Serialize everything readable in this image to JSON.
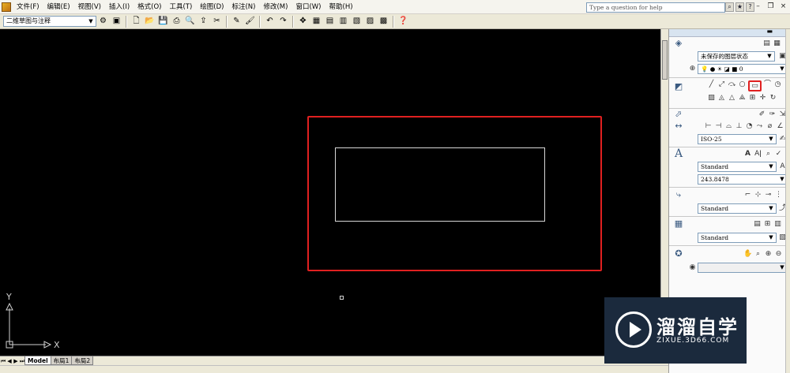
{
  "menu": {
    "items": [
      "文件(F)",
      "编辑(E)",
      "视图(V)",
      "插入(I)",
      "格式(O)",
      "工具(T)",
      "绘图(D)",
      "标注(N)",
      "修改(M)",
      "窗口(W)",
      "帮助(H)"
    ],
    "help_placeholder": "Type a question for help"
  },
  "toolbar": {
    "workspace": "二维草图与注释"
  },
  "layout_tabs": [
    "Model",
    "布局1",
    "布局2"
  ],
  "ucs": {
    "x_label": "X",
    "y_label": "Y"
  },
  "dashboard": {
    "layer_state": "未保存的图层状态",
    "layer_current": "0",
    "dim_style": "ISO-25",
    "text_style": "Standard",
    "text_height": "243.8478",
    "mleader_style": "Standard",
    "table_style": "Standard"
  },
  "watermark": {
    "title": "溜溜自学",
    "url": "ZIXUE.3D66.COM"
  },
  "colors": {
    "canvas": "#000000",
    "highlight": "#e02020",
    "geometry": "#d8d8d8"
  }
}
